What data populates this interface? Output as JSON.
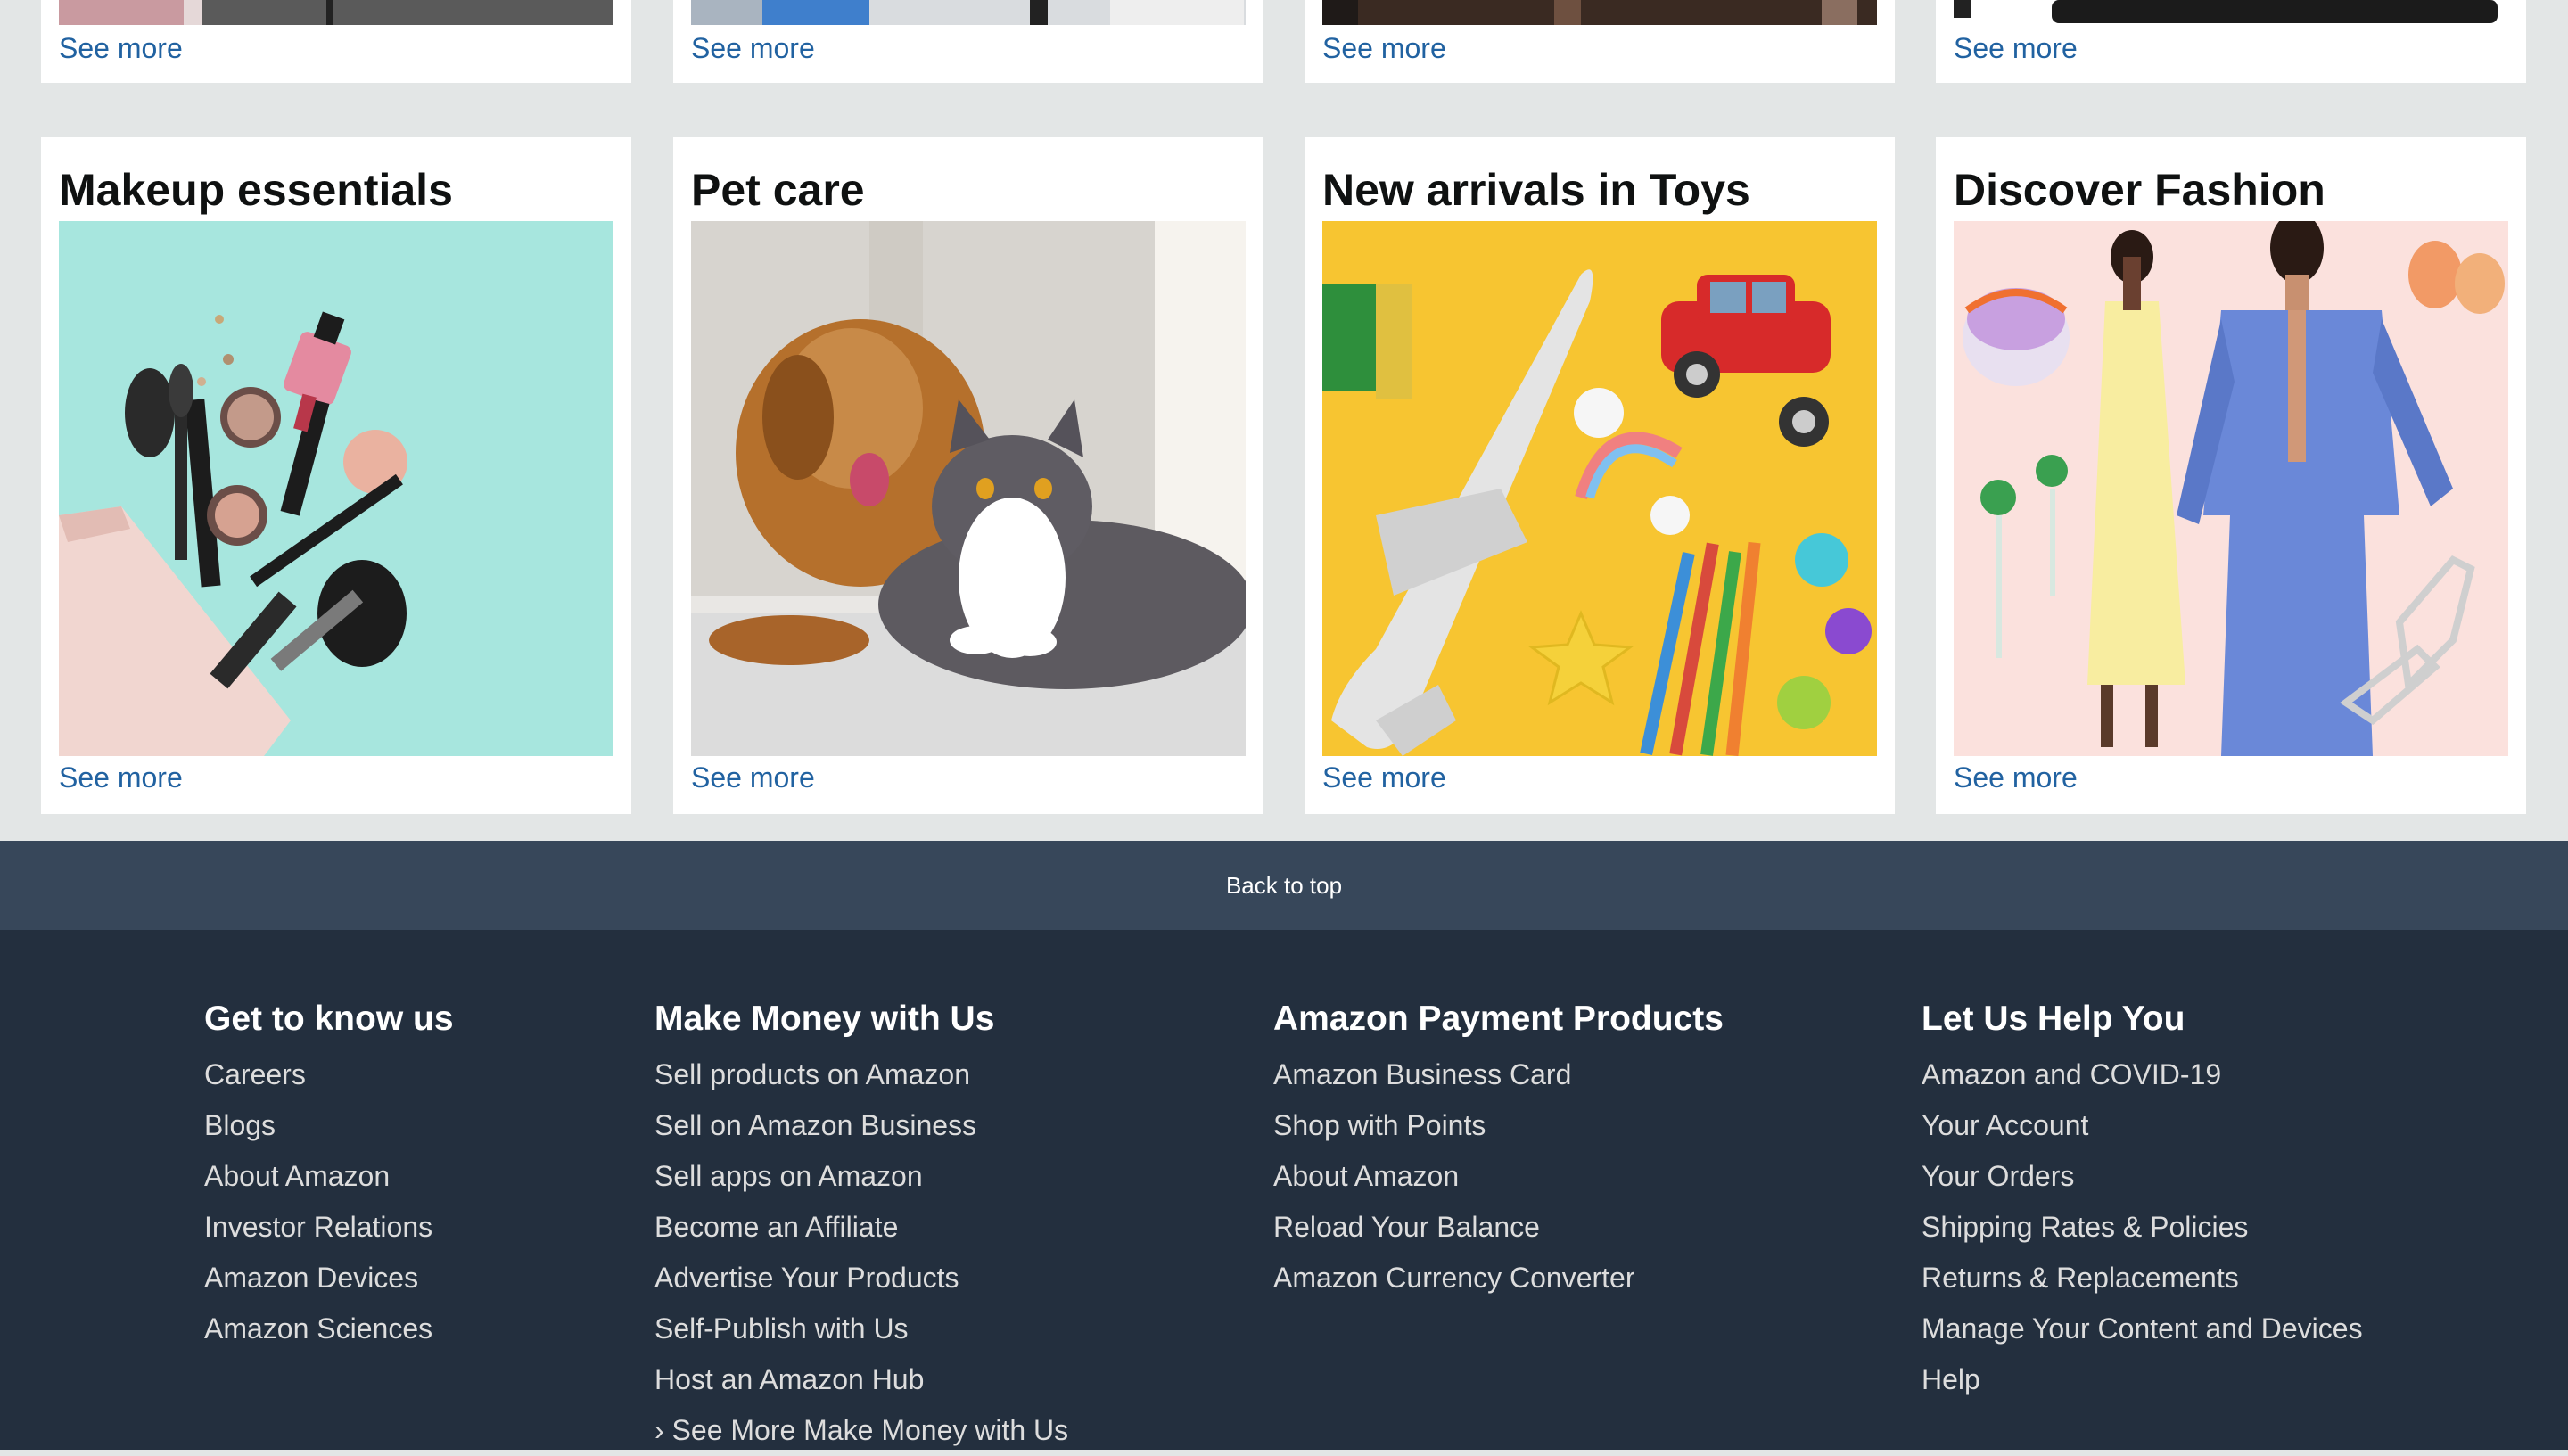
{
  "top_row": {
    "see_more": [
      "See more",
      "See more",
      "See more",
      "See more"
    ]
  },
  "cards": [
    {
      "title": "Makeup essentials",
      "see_more": "See more",
      "image": "makeup-products-photo"
    },
    {
      "title": "Pet care",
      "see_more": "See more",
      "image": "dog-and-cat-photo"
    },
    {
      "title": "New arrivals in Toys",
      "see_more": "See more",
      "image": "toys-photo"
    },
    {
      "title": "Discover Fashion",
      "see_more": "See more",
      "image": "fashion-models-photo"
    }
  ],
  "back_to_top": "Back to top",
  "footer": {
    "columns": [
      {
        "heading": "Get to know us",
        "links": [
          "Careers",
          "Blogs",
          "About Amazon",
          "Investor Relations",
          "Amazon Devices",
          "Amazon Sciences"
        ]
      },
      {
        "heading": "Make Money with Us",
        "links": [
          "Sell products on Amazon",
          "Sell on Amazon Business",
          "Sell apps on Amazon",
          "Become an Affiliate",
          "Advertise Your Products",
          "Self-Publish with Us",
          "Host an Amazon Hub",
          "› See More Make Money with Us"
        ]
      },
      {
        "heading": "Amazon Payment Products",
        "links": [
          "Amazon Business Card",
          "Shop with Points",
          "About Amazon",
          "Reload Your Balance",
          "Amazon Currency Converter"
        ]
      },
      {
        "heading": "Let Us Help You",
        "links": [
          "Amazon and COVID-19",
          "Your Account",
          "Your Orders",
          "Shipping Rates & Policies",
          "Returns & Replacements",
          "Manage Your Content and Devices",
          "Help"
        ]
      }
    ]
  },
  "colors": {
    "page_bg": "#e3e6e6",
    "link_blue": "#2162a1",
    "back_to_top_bg": "#37475a",
    "footer_bg": "#232f3e"
  }
}
